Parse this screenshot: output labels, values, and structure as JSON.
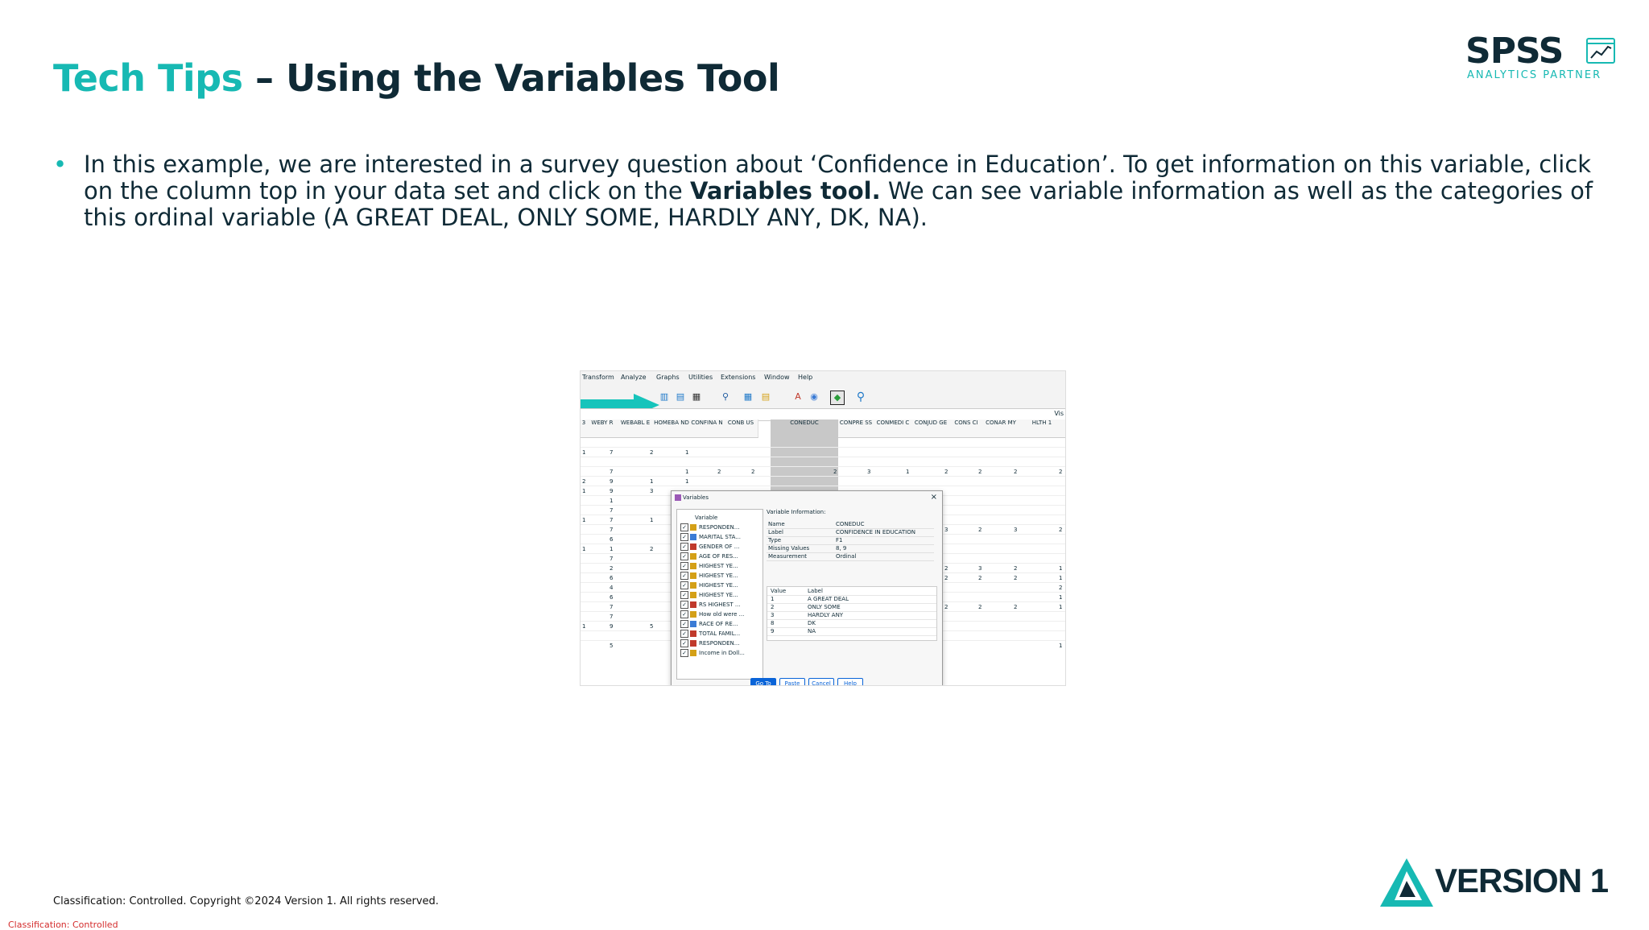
{
  "slide": {
    "title_accent": "Tech Tips",
    "title_rest": " – Using the Variables Tool",
    "bullet_text_1": "In this example, we are interested in a survey question about ‘Confidence in Education’. To get information on this variable, click on the column top in your data set and click on the ",
    "bullet_bold": "Variables tool.",
    "bullet_text_2": " We can see variable information as well as the categories of this ordinal variable (A GREAT DEAL, ONLY SOME, HARDLY ANY, DK, NA).",
    "copyright": "Classification: Controlled. Copyright ©2024 Version 1. All rights reserved.",
    "classification": "Classification: Controlled"
  },
  "logos": {
    "spss_word": "SPSS",
    "spss_sub": "ANALYTICS PARTNER",
    "version1_word": "VERSION 1"
  },
  "colors": {
    "accent": "#17b9b3",
    "dark": "#0f2a36",
    "classification_red": "#d42d2d"
  },
  "screenshot": {
    "menu": [
      "Transform",
      "Analyze",
      "Graphs",
      "Utilities",
      "Extensions",
      "Window",
      "Help"
    ],
    "toolbar_icons": [
      "data-view-icon",
      "variable-view-icon",
      "binoculars-icon",
      "grid-icon",
      "table-icon",
      "value-labels-icon",
      "circles-icon",
      "variables-tool-icon",
      "search-icon"
    ],
    "visible_label": "Vis",
    "columns": [
      "WEBY R",
      "WEBABL E",
      "HOMEBA ND",
      "CONFINA N",
      "CONB US",
      "CONEDUC",
      "CONPRE SS",
      "CONMEDI C",
      "CONJUD GE",
      "CONS CI",
      "CONAR MY",
      "HLTH 1"
    ],
    "row_first_col": [
      "1",
      "",
      "",
      "2",
      "1",
      "",
      "",
      "1",
      "",
      "",
      "1",
      "",
      "",
      "",
      "",
      "",
      "",
      "",
      "1",
      "",
      ""
    ],
    "dialog": {
      "title": "Variables",
      "list_header": "Variable",
      "variables": [
        "RESPONDEN...",
        "MARITAL STA...",
        "GENDER OF ...",
        "AGE OF RES...",
        "HIGHEST YE...",
        "HIGHEST YE...",
        "HIGHEST YE...",
        "HIGHEST YE...",
        "RS HIGHEST ...",
        "How old were ...",
        "RACE OF RE...",
        "TOTAL FAMIL...",
        "RESPONDEN...",
        "Income in Doll..."
      ],
      "info_header": "Variable Information:",
      "info": [
        {
          "key": "Name",
          "value": "CONEDUC"
        },
        {
          "key": "Label",
          "value": "CONFIDENCE IN EDUCATION"
        },
        {
          "key": "Type",
          "value": "F1"
        },
        {
          "key": "Missing Values",
          "value": "8, 9"
        },
        {
          "key": "Measurement",
          "value": "Ordinal"
        }
      ],
      "value_header": "Value",
      "label_header": "Label",
      "value_labels": [
        {
          "value": "1",
          "label": "A GREAT DEAL"
        },
        {
          "value": "2",
          "label": "ONLY SOME"
        },
        {
          "value": "3",
          "label": "HARDLY ANY"
        },
        {
          "value": "8",
          "label": "DK"
        },
        {
          "value": "9",
          "label": "NA"
        }
      ],
      "buttons": [
        "Go To",
        "Paste",
        "Cancel",
        "Help"
      ]
    }
  }
}
